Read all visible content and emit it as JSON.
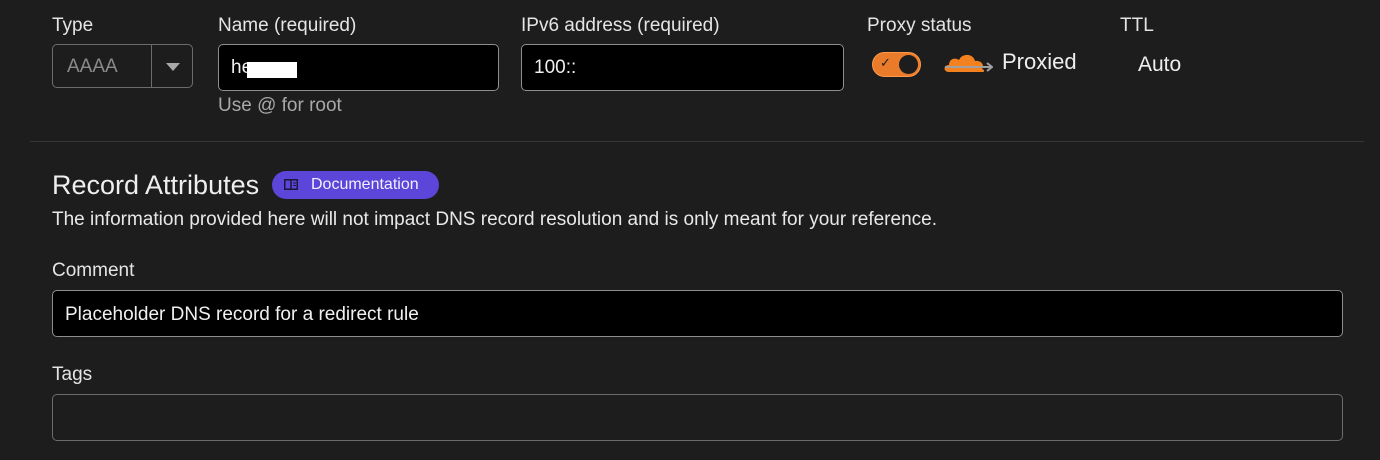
{
  "record": {
    "type_label": "Type",
    "type_value": "AAAA",
    "name_label": "Name (required)",
    "name_value": "he",
    "name_hint": "Use @ for root",
    "ipv6_label": "IPv6 address (required)",
    "ipv6_value": "100::",
    "proxy_label": "Proxy status",
    "proxy_value": "Proxied",
    "ttl_label": "TTL",
    "ttl_value": "Auto"
  },
  "attributes": {
    "title": "Record Attributes",
    "doc_label": "Documentation",
    "description": "The information provided here will not impact DNS record resolution and is only meant for your reference.",
    "comment_label": "Comment",
    "comment_value": "Placeholder DNS record for a redirect rule",
    "tags_label": "Tags",
    "tags_value": ""
  },
  "icons": {
    "type_chevron": "chevron-down-icon",
    "toggle_check": "check-icon",
    "proxy_cloud": "cloud-icon",
    "doc_book": "book-icon"
  },
  "colors": {
    "background": "#1d1d1d",
    "accent_orange": "#e97b2a",
    "badge_purple": "#5b46d9"
  }
}
